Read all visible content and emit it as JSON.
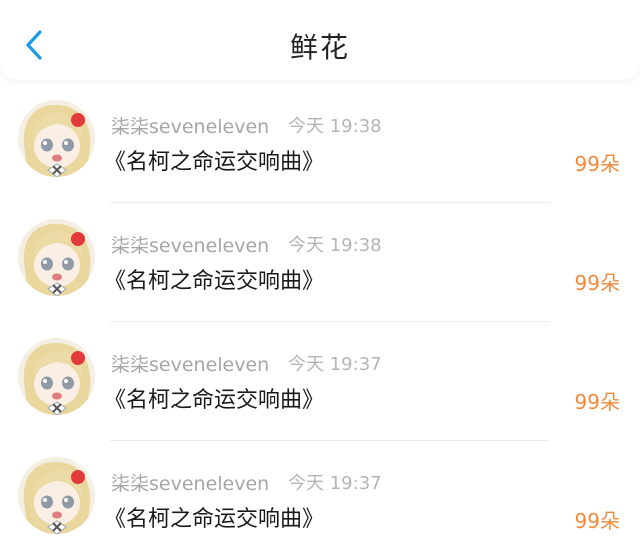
{
  "header": {
    "back_icon": "chevron-left-icon",
    "title": "鲜花",
    "accent_color": "#1a9bea"
  },
  "records": [
    {
      "username": "柒柒seveneleven",
      "time": "今天 19:38",
      "message": "《名柯之命运交响曲》",
      "amount": "99朵"
    },
    {
      "username": "柒柒seveneleven",
      "time": "今天 19:38",
      "message": "《名柯之命运交响曲》",
      "amount": "99朵"
    },
    {
      "username": "柒柒seveneleven",
      "time": "今天 19:37",
      "message": "《名柯之命运交响曲》",
      "amount": "99朵"
    },
    {
      "username": "柒柒seveneleven",
      "time": "今天 19:37",
      "message": "《名柯之命运交响曲》",
      "amount": "99朵"
    }
  ],
  "colors": {
    "amount": "#f08a3c",
    "username": "#a6a6a6",
    "time": "#b5b5b5"
  }
}
